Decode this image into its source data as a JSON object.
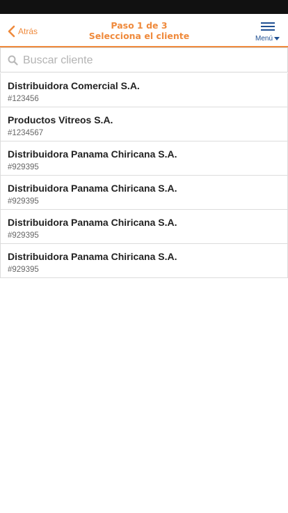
{
  "header": {
    "back_label": "Atrás",
    "step": "Paso 1 de 3",
    "title": "Selecciona el cliente",
    "menu_label": "Menú",
    "accent_color": "#ef8a3c",
    "menu_color": "#1f4f92"
  },
  "search": {
    "placeholder": "Buscar cliente",
    "value": ""
  },
  "clients": [
    {
      "name": "Distribuidora Comercial S.A.",
      "code": "#123456"
    },
    {
      "name": "Productos Vitreos S.A.",
      "code": "#1234567"
    },
    {
      "name": "Distribuidora Panama Chiricana S.A.",
      "code": "#929395"
    },
    {
      "name": "Distribuidora Panama Chiricana S.A.",
      "code": "#929395"
    },
    {
      "name": "Distribuidora Panama Chiricana S.A.",
      "code": "#929395"
    },
    {
      "name": "Distribuidora Panama Chiricana S.A.",
      "code": "#929395"
    }
  ]
}
